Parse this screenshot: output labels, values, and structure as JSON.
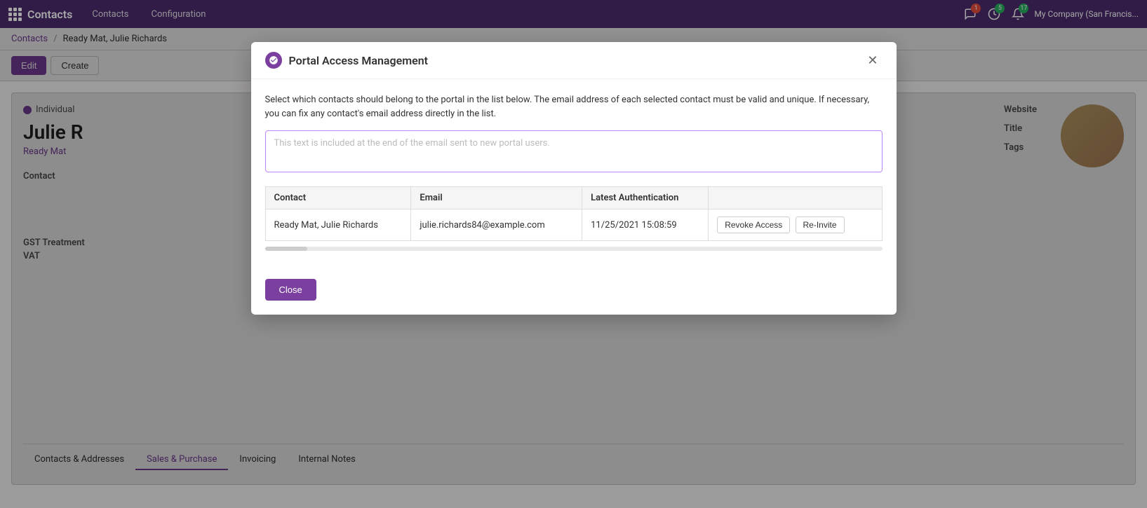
{
  "app": {
    "name": "Contacts"
  },
  "topnav": {
    "brand": "Contacts",
    "links": [
      "Contacts",
      "Configuration"
    ],
    "company": "My Company (San Francis...",
    "badge1_count": "1",
    "badge2_count": "5",
    "badge3_count": "17"
  },
  "breadcrumb": {
    "root": "Contacts",
    "current": "Ready Mat, Julie Richards",
    "separator": "/"
  },
  "actions": {
    "edit_label": "Edit",
    "create_label": "Create"
  },
  "contact": {
    "type": "Individual",
    "name": "Julie R",
    "company": "Ready Mat",
    "section_contact": "Contact",
    "section_gst": "GST Treatment",
    "section_vat": "VAT",
    "right_website": "Website",
    "right_title": "Title",
    "right_tags": "Tags"
  },
  "tabs": [
    {
      "label": "Contacts & Addresses"
    },
    {
      "label": "Sales & Purchase"
    },
    {
      "label": "Invoicing"
    },
    {
      "label": "Internal Notes"
    }
  ],
  "modal": {
    "title": "Portal Access Management",
    "description": "Select which contacts should belong to the portal in the list below. The email address of each selected contact must be valid and unique. If necessary, you can fix any contact's email address directly in the list.",
    "textarea_placeholder": "This text is included at the end of the email sent to new portal users.",
    "table_headers": [
      "Contact",
      "Email",
      "Latest Authentication",
      ""
    ],
    "table_row": {
      "contact": "Ready Mat, Julie Richards",
      "email": "julie.richards84@example.com",
      "auth": "11/25/2021 15:08:59",
      "btn_revoke": "Revoke Access",
      "btn_reinvite": "Re-Invite"
    },
    "close_label": "Close"
  }
}
